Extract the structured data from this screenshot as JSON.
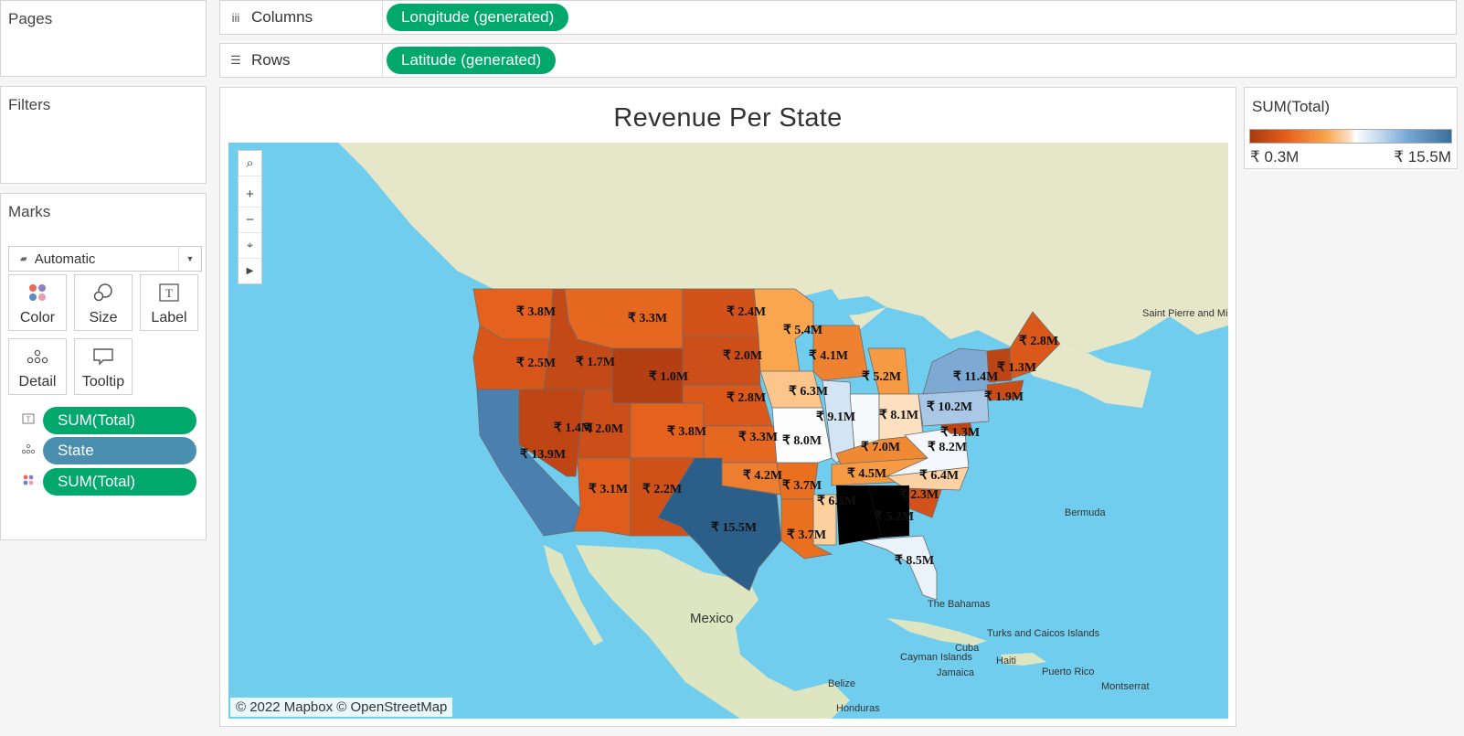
{
  "left_panel": {
    "pages_title": "Pages",
    "filters_title": "Filters",
    "marks_title": "Marks",
    "mark_type": "Automatic",
    "mark_buttons": [
      {
        "label": "Color",
        "icon": "color-dots-icon"
      },
      {
        "label": "Size",
        "icon": "size-circles-icon"
      },
      {
        "label": "Label",
        "icon": "label-text-icon"
      },
      {
        "label": "Detail",
        "icon": "detail-dots-icon"
      },
      {
        "label": "Tooltip",
        "icon": "tooltip-bubble-icon"
      }
    ],
    "mark_fields": [
      {
        "label": "SUM(Total)",
        "role": "label",
        "color": "#00a86b"
      },
      {
        "label": "State",
        "role": "detail",
        "color": "#4a8fb0"
      },
      {
        "label": "SUM(Total)",
        "role": "color",
        "color": "#00a86b"
      }
    ]
  },
  "shelves": {
    "columns": {
      "label": "Columns",
      "pill": "Longitude (generated)"
    },
    "rows": {
      "label": "Rows",
      "pill": "Latitude (generated)"
    }
  },
  "viz": {
    "title": "Revenue Per State",
    "attribution": "© 2022 Mapbox © OpenStreetMap",
    "place_labels": [
      "Mexico",
      "Saint Pierre and Miquelon",
      "Bermuda",
      "The Bahamas",
      "Turks and Caicos Islands",
      "Cayman Islands",
      "Cuba",
      "Haiti",
      "Puerto Rico",
      "Jamaica",
      "Belize",
      "Honduras",
      "Montserrat"
    ],
    "map_tools": [
      "search-icon",
      "zoom-in-icon",
      "zoom-out-icon",
      "reset-map-icon",
      "expand-toolbar-icon"
    ]
  },
  "legend": {
    "title": "SUM(Total)",
    "min": "₹ 0.3M",
    "max": "₹ 15.5M",
    "color_low": "#a93a0f",
    "color_mid": "#ffffff",
    "color_high": "#2c5e8a"
  },
  "states": [
    {
      "label": "₹ 3.8M",
      "color": "#e4621d"
    },
    {
      "label": "₹ 2.5M",
      "color": "#d8561a"
    },
    {
      "label": "₹ 1.7M",
      "color": "#c34a17"
    },
    {
      "label": "₹ 3.3M",
      "color": "#e6671f"
    },
    {
      "label": "₹ 1.0M",
      "color": "#b33f12"
    },
    {
      "label": "₹ 2.4M",
      "color": "#d35219"
    },
    {
      "label": "₹ 2.0M",
      "color": "#cc4e18"
    },
    {
      "label": "₹ 5.4M",
      "color": "#f9a64e"
    },
    {
      "label": "₹ 13.9M",
      "color": "#4a7fb0"
    },
    {
      "label": "₹ 1.4M",
      "color": "#bf4515"
    },
    {
      "label": "₹ 2.0M",
      "color": "#cc4e18"
    },
    {
      "label": "₹ 3.8M",
      "color": "#e4621d"
    },
    {
      "label": "₹ 2.8M",
      "color": "#d9581a"
    },
    {
      "label": "₹ 3.3M",
      "color": "#e6671f"
    },
    {
      "label": "₹ 6.3M",
      "color": "#fbc58c"
    },
    {
      "label": "₹ 3.1M",
      "color": "#df5c1b"
    },
    {
      "label": "₹ 2.2M",
      "color": "#d05118"
    },
    {
      "label": "₹ 15.5M",
      "color": "#2c5e8a"
    },
    {
      "label": "₹ 4.2M",
      "color": "#ee7e2f"
    },
    {
      "label": "₹ 3.7M",
      "color": "#e8701f"
    },
    {
      "label": "₹ 6.5M",
      "color": "#fccf9e"
    },
    {
      "label": "₹ 3.7M",
      "color": "#e8701f"
    },
    {
      "label": "₹ 8.0M",
      "color": "#fdfdfd"
    },
    {
      "label": "₹ 4.1M",
      "color": "#ef8230"
    },
    {
      "label": "₹ 9.1M",
      "color": "#d3e5f4"
    },
    {
      "label": "₹ 5.2M",
      "color": "#f69a43"
    },
    {
      "label": "₹ 8.1M",
      "color": "#f7fafd"
    },
    {
      "label": "₹ 7.0M",
      "color": "#fde0bf"
    },
    {
      "label": "₹ 4.5M",
      "color": "#f08934"
    },
    {
      "label": "₹ 5.2M",
      "color": "#f69a43"
    },
    {
      "label": "₹ 8.5M",
      "color": "#eaf2fa"
    },
    {
      "label": "₹ 2.3M",
      "color": "#d35219"
    },
    {
      "label": "₹ 6.4M",
      "color": "#fcd2a5"
    },
    {
      "label": "₹ 8.2M",
      "color": "#f4f8fc"
    },
    {
      "label": "₹ 1.3M",
      "color": "#bd4415"
    },
    {
      "label": "₹ 10.2M",
      "color": "#a9c8e6"
    },
    {
      "label": "₹ 11.4M",
      "color": "#7ea9d3"
    },
    {
      "label": "₹ 1.9M",
      "color": "#ca4d17"
    },
    {
      "label": "₹ 1.3M",
      "color": "#bd4415"
    },
    {
      "label": "₹ 2.8M",
      "color": "#d9581a"
    }
  ]
}
